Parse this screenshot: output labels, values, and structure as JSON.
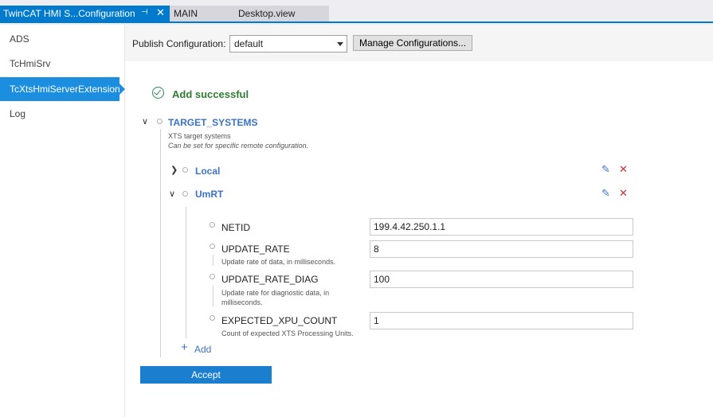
{
  "tabs": {
    "active": {
      "title": "TwinCAT HMI S...Configuration",
      "pin": "⊣",
      "close": "✕"
    },
    "main": {
      "title": "MAIN",
      "secondary": "Desktop.view"
    }
  },
  "sidebar": {
    "items": [
      {
        "label": "ADS"
      },
      {
        "label": "TcHmiSrv"
      },
      {
        "label": "TcXtsHmiServerExtension"
      },
      {
        "label": "Log"
      }
    ]
  },
  "toolbar": {
    "publish_label": "Publish Configuration:",
    "publish_value": "default",
    "manage_label": "Manage Configurations..."
  },
  "status": {
    "text": "Add successful"
  },
  "tree": {
    "root": {
      "title": "TARGET_SYSTEMS",
      "desc": "XTS target systems",
      "desc_italic": "Can be set for specific remote configuration."
    },
    "local": {
      "title": "Local"
    },
    "umrt": {
      "title": "UmRT"
    },
    "properties": [
      {
        "name": "NETID",
        "desc": "",
        "value": "199.4.42.250.1.1"
      },
      {
        "name": "UPDATE_RATE",
        "desc": "Update rate of data, in milliseconds.",
        "value": "8"
      },
      {
        "name": "UPDATE_RATE_DIAG",
        "desc": "Update rate for diagnostic data, in milliseconds.",
        "value": "100"
      },
      {
        "name": "EXPECTED_XPU_COUNT",
        "desc": "Count of expected XTS Processing Units.",
        "value": "1"
      }
    ],
    "add_label": "Add"
  },
  "accept_label": "Accept",
  "colors": {
    "accent": "#007acc",
    "link": "#3b73c6",
    "success": "#2e7d32",
    "delete": "#d0312d"
  }
}
